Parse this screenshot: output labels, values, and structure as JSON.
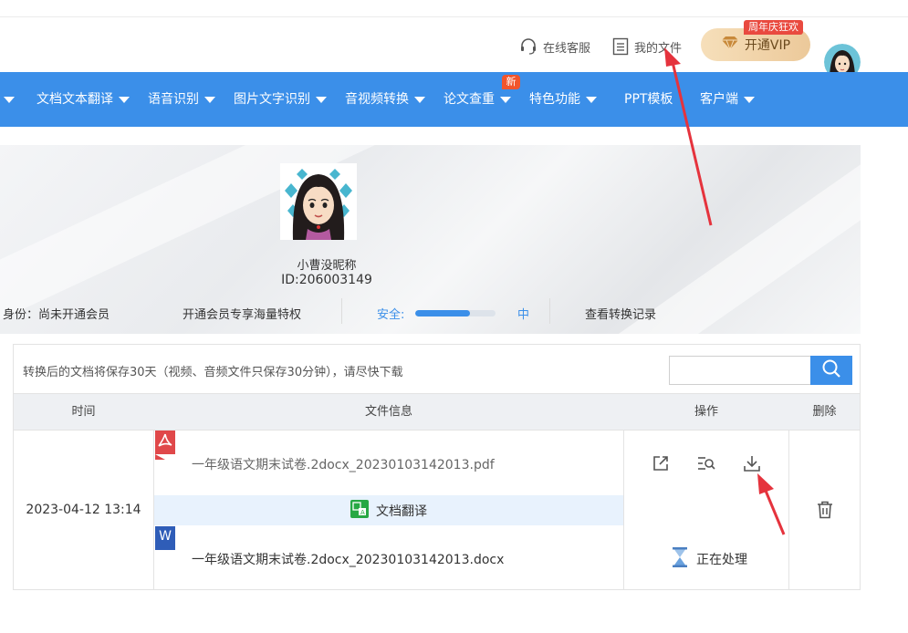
{
  "header": {
    "customer_service_label": "在线客服",
    "my_files_label": "我的文件",
    "vip_label": "开通VIP",
    "vip_badge": "周年庆狂欢"
  },
  "nav": {
    "items": [
      {
        "label": "文档文本翻译"
      },
      {
        "label": "语音识别"
      },
      {
        "label": "图片文字识别"
      },
      {
        "label": "音视频转换"
      },
      {
        "label": "论文查重"
      },
      {
        "label": "特色功能"
      },
      {
        "label": "PPT模板"
      },
      {
        "label": "客户端"
      }
    ],
    "new_badge": "新"
  },
  "profile": {
    "nickname": "小曹没昵称",
    "user_id": "ID:206003149",
    "identity": "身份：尚未开通会员",
    "vip_privilege": "开通会员专享海量特权",
    "security_label": "安全:",
    "security_level": "中",
    "security_progress": 0.68,
    "history_link": "查看转换记录"
  },
  "files": {
    "notice": "转换后的文档将保存30天（视频、音频文件只保存30分钟），请尽快下载",
    "search_placeholder": "",
    "columns": [
      "时间",
      "文件信息",
      "操作",
      "删除"
    ],
    "rows": [
      {
        "time": "2023-04-12 13:14",
        "source_tag": "W",
        "source_name": "一年级语文期末试卷.2docx_20230103142013.docx",
        "action": "文档翻译",
        "result_name": "一年级语文期末试卷.2docx_20230103142013.pdf",
        "status": "正在处理"
      }
    ]
  },
  "colors": {
    "primary": "#3b8fe9",
    "pdf_red": "#e0484a",
    "word_blue": "#2f5db8",
    "badge_red": "#e94a3f",
    "arrow_red": "#e5333d"
  }
}
